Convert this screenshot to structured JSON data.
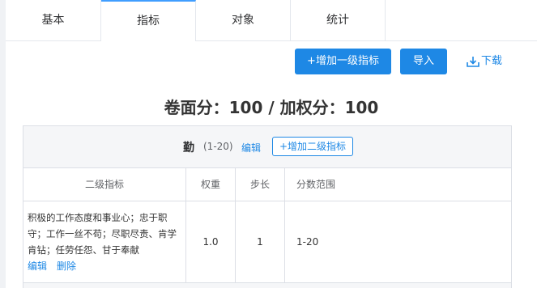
{
  "tabs": [
    "基本",
    "指标",
    "对象",
    "统计"
  ],
  "actions": {
    "add_first_level": "+增加一级指标",
    "import": "导入",
    "download": "下载"
  },
  "score_line": "卷面分：100 / 加权分：100",
  "group": {
    "name": "勤",
    "range": "(1-20)",
    "edit": "编辑",
    "add_second_level": "+增加二级指标"
  },
  "table": {
    "headers": [
      "二级指标",
      "权重",
      "步长",
      "分数范围"
    ],
    "rows": [
      {
        "indicator": "积极的工作态度和事业心；忠于职守；工作一丝不苟；尽职尽责、肯学肯钻；任劳任怨、甘于奉献",
        "weight": "1.0",
        "step": "1",
        "range": "1-20",
        "edit": "编辑",
        "delete": "删除"
      }
    ]
  },
  "colors": {
    "accent": "#1e88e5",
    "active_tab_border": "#409eff"
  }
}
